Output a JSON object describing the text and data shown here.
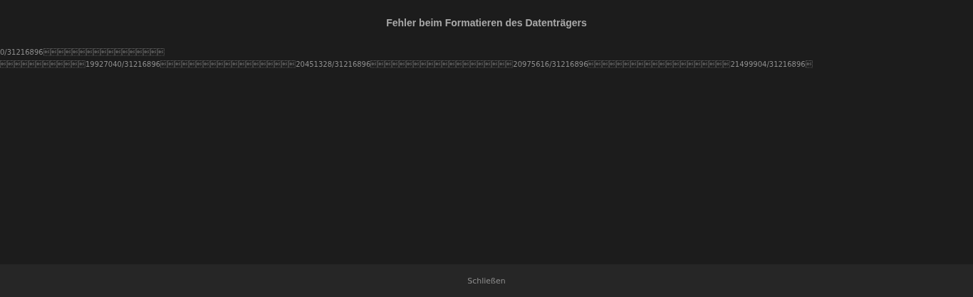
{
  "dialog": {
    "title": "Fehler beim Formatieren des Datenträgers",
    "message_lines": [
      "0/31216896\b\b\b\b\b\b\b\b\b\b\b\b\b\b\b\b\b",
      "\b\b\b\b\b\b\b\b\b\b\b\b19927040/31216896\b\b\b\b\b\b\b\b\b\b\b\b\b\b\b\b\b\b\b20451328/31216896\b\b\b\b\b\b\b\b\b\b\b\b\b\b\b\b\b\b\b\b20975616/31216896\b\b\b\b\b\b\b\b\b\b\b\b\b\b\b\b\b\b\b\b21499904/31216896\b"
    ],
    "close_button": "Schließen"
  }
}
